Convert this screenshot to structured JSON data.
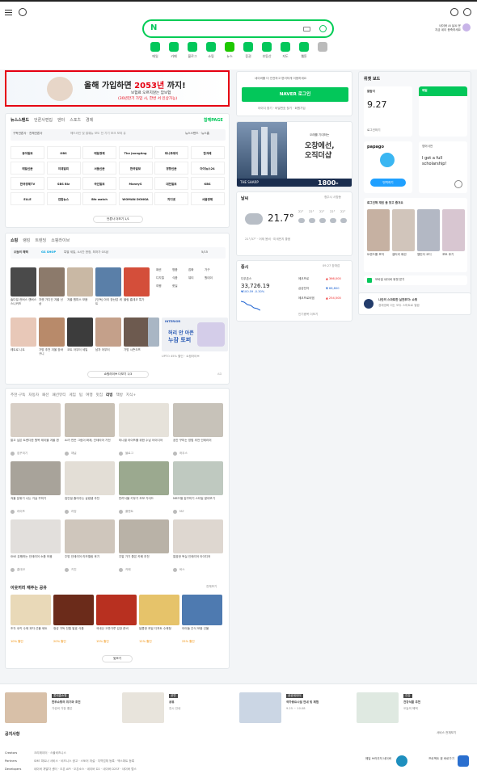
{
  "header": {
    "search_logo": "N",
    "user_line1": "네이버 AI 날씨 운",
    "user_line2": "지금 네이 응축하세요",
    "services": [
      {
        "label": "메일",
        "color": "#03c75a"
      },
      {
        "label": "카페",
        "color": "#03c75a"
      },
      {
        "label": "블로그",
        "color": "#03c75a"
      },
      {
        "label": "쇼핑",
        "color": "#03c75a"
      },
      {
        "label": "뉴스",
        "color": "#1ec800"
      },
      {
        "label": "증권",
        "color": "#03c75a"
      },
      {
        "label": "부동산",
        "color": "#03c75a"
      },
      {
        "label": "지도",
        "color": "#03c75a"
      },
      {
        "label": "웹툰",
        "color": "#03c75a"
      },
      {
        "label": "",
        "color": "#bbbbbb"
      }
    ]
  },
  "ad_banner": {
    "headline_a": "올해 가입하면 ",
    "headline_b": "2053년",
    "headline_c": " 까지!",
    "sub1": "보험료 오르지않는 암보험",
    "sub2": "(30년만기 가입 시, 한번 서 인상가능)"
  },
  "news": {
    "tabs": [
      "뉴스스탠드",
      "언론사편집",
      "엔터",
      "스포츠",
      "경제"
    ],
    "tab_right": "함께PAGE",
    "sub_left": "구독언론사 · 전체언론사",
    "sub_mid": "헤드라인 및 발췌뉴 보도 전 기기 모크 보여 유",
    "sub_right": "뉴스스탠드 · 뉴스홈",
    "brands": [
      "동아일보",
      "OBS",
      "매일경제",
      "The JoongAng",
      "머니투데이",
      "한겨레",
      "매일신문",
      "이데일리",
      "서울신문",
      "한국일보",
      "경향신문",
      "아이뉴스24",
      "한국경제TV",
      "SBS Biz",
      "국민일보",
      "MoneyS",
      "대전일보",
      "KBS",
      "ELLE",
      "연합뉴스",
      "Bfz watch",
      "WOMAN DONGA",
      "지디넷",
      "서울경제"
    ],
    "pager_label": "언론사 더보기 1/1"
  },
  "shopping": {
    "tabs": [
      "쇼핑",
      "랭킹",
      "트렌딩",
      "쇼핑라이브"
    ],
    "promo_title": "오늘의 혜택",
    "promo_brand": "GS SHOP",
    "promo_text": "특별 세일, 4시간 한정, 최저가 GS샵",
    "pager": "5/15",
    "items": [
      "솔다일 컨버스 캔버스 스니커즈",
      "자켓 가디건 겨울 신상",
      "겨울 원피스 모음",
      "[단독] 아이 장난감 세트",
      "블링 홈데코 특가",
      "레트로 니트",
      "가방 추천 겨울 장바구니",
      "코트 아우터 세일",
      "남자 아우터",
      "가방 시즌오프",
      "가을 데일리룩"
    ],
    "side_filters": [
      "패션",
      "명품",
      "잡화",
      "가구",
      "디지털",
      "식품",
      "뷰티",
      "원데이",
      "여행",
      "핫딜"
    ],
    "ad_brand": "INTERIOR",
    "ad_text1": "허리 안 아픈",
    "ad_text2": "누잠 토퍼",
    "ad_caption": "UPTO 45% 할인 · 쇼핑라이브",
    "pager_label": "쇼핑라이브 더보기 1/3",
    "ad_tag": "AD"
  },
  "feed": {
    "tabs": [
      "추천·구독",
      "자동차",
      "패션",
      "패션뷰티",
      "게임",
      "팁",
      "여행",
      "맛집",
      "리빙",
      "책방",
      "지식+"
    ],
    "posts": [
      {
        "title": "알고 싶은 트렌디한 원목 테이블 겨울 편",
        "author": "집꾸미기"
      },
      {
        "title": "AI가 만든 그림이 화제, 인테리어 가전",
        "author": "채널"
      },
      {
        "title": "미니멀 라이프를 위한 수납 아이디어",
        "author": "블로그"
      },
      {
        "title": "공간 꾸미는 방법 추천 인테리어",
        "author": "하우스"
      },
      {
        "title": "겨울 분위기 나는 거실 꾸미기",
        "author": "라이프"
      },
      {
        "title": "집안일 줄여주는 살림템 추천",
        "author": "리빙"
      },
      {
        "title": "반려식물 키우기 초보 가이드",
        "author": "플랜트"
      },
      {
        "title": "MBTI별 집꾸미기 스타일 알아보기",
        "author": "MZ"
      },
      {
        "title": "SNS 유행하는 인테리어 소품 모음",
        "author": "홈데코"
      },
      {
        "title": "주방 인테리어 리모델링 후기",
        "author": "키친"
      },
      {
        "title": "주말 가기 좋은 카페 추천",
        "author": "카페"
      },
      {
        "title": "깔끔한 욕실 인테리어 아이디어",
        "author": "바스"
      }
    ],
    "market_title": "이웃끼리 재주는 공유",
    "market_more": "전체보기",
    "market_items": [
      {
        "title": "조각 쿠키 수제 과자 선물 세트",
        "price": "10% 할인"
      },
      {
        "title": "정성 가득 전통 발효 식품",
        "price": "20% 할인"
      },
      {
        "title": "국내산 고춧가루 김장 준비",
        "price": "15% 할인"
      },
      {
        "title": "달콤한 과일 디저트 수제청",
        "price": "12% 할인"
      },
      {
        "title": "아이들 간식 모음 선물",
        "price": "25% 할인"
      }
    ],
    "more_label": "뒷보기"
  },
  "login": {
    "notice": "네이버를 더 안전하고 편리하게 이용하세요",
    "button": "NAVER 로그인",
    "links": "아이디 찾기 · 비밀번호 찾기 · 회원가입"
  },
  "right_ad": {
    "text1": "오래를 기대하는",
    "text2": "오창에선,",
    "text3": "오직더샵",
    "brand": "THE SHARP",
    "phone": "1800-0337"
  },
  "weather": {
    "title": "날씨",
    "loc": "청주시 사창동",
    "temp": "21.7°",
    "desc": "21°/37° · 어제 봄비 · 미세먼지 좋음",
    "hours": [
      "22°",
      "22°",
      "22°",
      "22°",
      "22°"
    ]
  },
  "stock": {
    "title": "증시",
    "time": "09.27 장마감",
    "index_name": "다우존스",
    "index_value": "33,726.19",
    "index_change": "▼100.59 -0.30%",
    "rows": [
      {
        "name": "에코프로",
        "value": "▲ 366,000"
      },
      {
        "name": "삼성전자",
        "value": "▼ 68,800"
      },
      {
        "name": "에코프로비엠",
        "value": "▲ 254,500"
      }
    ],
    "more": "인기종목 더보기"
  },
  "widgets": {
    "title": "위젯 보드",
    "mail_label": "알람이",
    "mail_time": "9.27",
    "mail_foot": "로그인하기",
    "tab2": "메일",
    "papago": "papago",
    "papago_q": "영어사전",
    "papago_text": "I got a full scholarship!",
    "papago_btn": "번역하기",
    "ai_title": "로그인해 재밌 을 찾고 즐겨요",
    "ai_items": [
      "트렌드를 포착",
      "갤러리 패션",
      "캘린더 코디",
      "포토 후기"
    ],
    "promo": "모바일 네이버 위젯 받기",
    "shop_banner1": "나만의 스마트한 실전투자: 쇼핑",
    "shop_banner2": "경제영화 이는 모두 스마트로 열람"
  },
  "footer": {
    "items": [
      {
        "tag": "롯데홈쇼핑",
        "title": "한우쇼핑의 위기와 조건",
        "sub": "가성비 가장 좋은"
      },
      {
        "tag": "공연",
        "title": "공유",
        "sub": "전시 안내"
      },
      {
        "tag": "공공데이터",
        "title": "국가중요시설 안내 및 체험",
        "sub": "9.25 ~ 10.08"
      },
      {
        "tag": "건강",
        "title": "건강식품 추천",
        "sub": "오늘의 혜택"
      }
    ],
    "notice_label": "공지사항",
    "service_all": "서비스 전체보기",
    "rows": [
      {
        "label": "Creators",
        "links": "크리에이터 · 스몰비즈니스"
      },
      {
        "label": "Partners",
        "links": "SME 파트너 서비스 · 비즈니스 광고 · 스토어 개설 · 지역업체 등록 · 엑스퍼트 등록"
      },
      {
        "label": "Developers",
        "links": "네이버 개발자 센터 · 오픈 API · 오픈소스 · 네이버 D2 · 네이버 D2SF · 네이버 랩스"
      }
    ],
    "badge1": "웨일 브라우저 네이버",
    "badge2": "프로젝트 꽃 바로가기"
  }
}
